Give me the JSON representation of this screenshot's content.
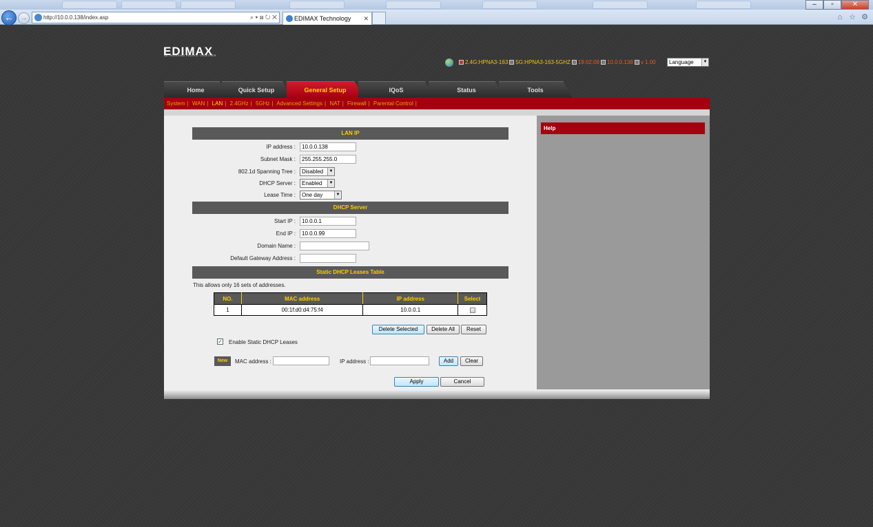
{
  "browser": {
    "url": "http://10.0.0.138/index.asp",
    "tab_title": "EDIMAX Technology",
    "back_glyph": "←",
    "forward_glyph": "→",
    "addr_tools": "⌕ ▾ ⊠ ↻ ✕",
    "tab_close": "✕",
    "minimize": "–",
    "maximize": "▫",
    "close": "✕",
    "home_icon": "⌂",
    "favorites_icon": "☆",
    "tools_icon": "⚙"
  },
  "brand": {
    "logo_text": "EDIMAX",
    "tagline": "NETWORKING PEOPLE TOGETHER"
  },
  "status": {
    "band1": "2.4G",
    "ssid1": "HPNA3-163",
    "band2": "5G",
    "ssid2": "HPNA3-163-5GHZ",
    "time": "19:02:09",
    "ip": "10.0.0.138",
    "version": "v 1.00",
    "sep": " : "
  },
  "language": {
    "value": "Language",
    "arrow": "▼"
  },
  "main_tabs": [
    {
      "label": "Home"
    },
    {
      "label": "Quick Setup"
    },
    {
      "label": "General Setup"
    },
    {
      "label": "IQoS"
    },
    {
      "label": "Status"
    },
    {
      "label": "Tools"
    }
  ],
  "sub_nav": [
    {
      "label": "System"
    },
    {
      "label": "WAN"
    },
    {
      "label": "LAN"
    },
    {
      "label": "2.4GHz"
    },
    {
      "label": "5GHz"
    },
    {
      "label": "Advanced Settings"
    },
    {
      "label": "NAT"
    },
    {
      "label": "Firewall"
    },
    {
      "label": "Parental Control"
    }
  ],
  "sub_nav_sep": "|",
  "lan_ip": {
    "title": "LAN IP",
    "ip_label": "IP address :",
    "ip_value": "10.0.0.138",
    "mask_label": "Subnet Mask :",
    "mask_value": "255.255.255.0",
    "stp_label": "802.1d Spanning Tree :",
    "stp_value": "Disabled",
    "dhcp_label": "DHCP Server :",
    "dhcp_value": "Enabled",
    "lease_label": "Lease Time :",
    "lease_value": "One day"
  },
  "dhcp_server": {
    "title": "DHCP Server",
    "start_label": "Start IP :",
    "start_value": "10.0.0.1",
    "end_label": "End IP :",
    "end_value": "10.0.0.99",
    "domain_label": "Domain Name :",
    "domain_value": "",
    "gateway_label": "Default Gateway Address :",
    "gateway_value": ""
  },
  "static_table": {
    "title": "Static DHCP Leases Table",
    "note": "This allows only 16 sets of addresses.",
    "headers": {
      "no": "NO.",
      "mac": "MAC address",
      "ip": "IP address",
      "select": "Select"
    },
    "rows": [
      {
        "no": "1",
        "mac": "00:1f:d0:d4:75:f4",
        "ip": "10.0.0.1",
        "selected": false
      }
    ]
  },
  "actions": {
    "delete_selected": "Delete Selected",
    "delete_all": "Delete All",
    "reset": "Reset",
    "enable_static_label": "Enable Static DHCP Leases",
    "enable_static_checked": true,
    "check_glyph": "✓",
    "new_tag": "New",
    "mac_label": "MAC address :",
    "ip_label": "IP address :",
    "add": "Add",
    "clear": "Clear",
    "apply": "Apply",
    "cancel": "Cancel"
  },
  "help": {
    "title": "Help"
  }
}
